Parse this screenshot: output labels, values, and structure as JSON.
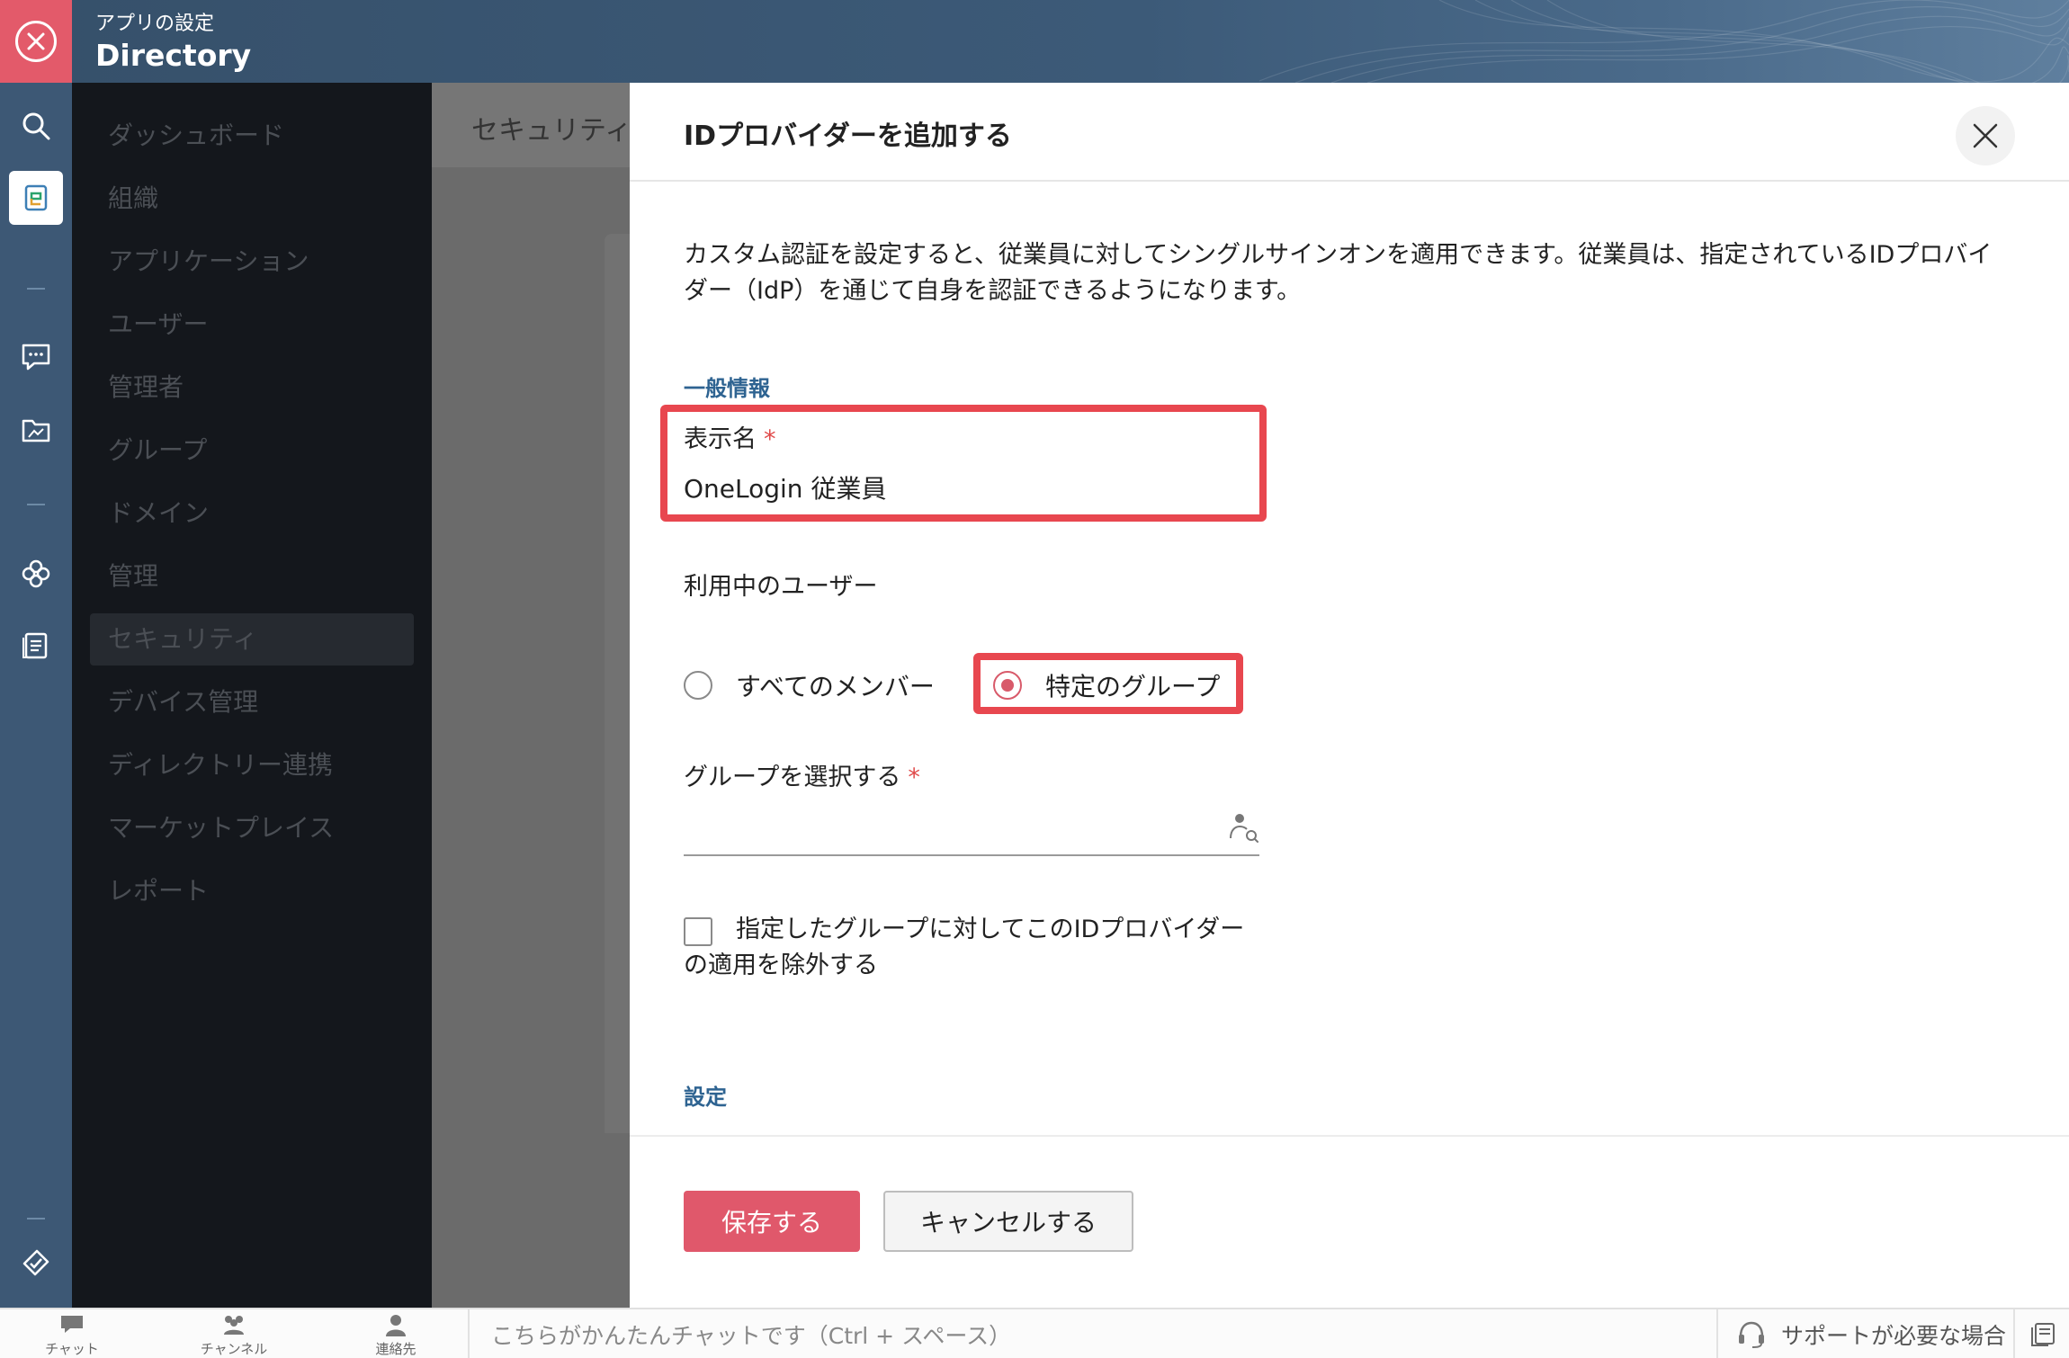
{
  "header": {
    "subtitle": "アプリの設定",
    "title": "Directory"
  },
  "rail": {
    "items": [
      "search-icon",
      "directory-app-icon",
      "chat-icon",
      "folder-icon",
      "clover-icon",
      "notes-icon",
      "tickets-icon"
    ]
  },
  "nav": {
    "items": [
      {
        "label": "ダッシュボード"
      },
      {
        "label": "組織"
      },
      {
        "label": "アプリケーション"
      },
      {
        "label": "ユーザー"
      },
      {
        "label": "管理者"
      },
      {
        "label": "グループ"
      },
      {
        "label": "ドメイン"
      },
      {
        "label": "管理"
      },
      {
        "label": "セキュリティ",
        "active": true
      },
      {
        "label": "デバイス管理"
      },
      {
        "label": "ディレクトリー連携"
      },
      {
        "label": "マーケットプレイス"
      },
      {
        "label": "レポート"
      }
    ]
  },
  "main": {
    "tab_label": "セキュリティ"
  },
  "panel": {
    "title": "IDプロバイダーを追加する",
    "description": "カスタム認証を設定すると、従業員に対してシングルサインオンを適用できます。従業員は、指定されているIDプロバイダー（IdP）を通じて自身を認証できるようになります。",
    "general_section": "一般情報",
    "display_name_label": "表示名",
    "required_mark": "*",
    "display_name_value": "OneLogin 従業員",
    "users_label": "利用中のユーザー",
    "radio_all_label": "すべてのメンバー",
    "radio_group_label": "特定のグループ",
    "selected_radio": "特定のグループ",
    "select_group_label": "グループを選択する",
    "exclude_label": "指定したグループに対してこのIDプロバイダーの適用を除外する",
    "settings_section": "設定",
    "save_label": "保存する",
    "cancel_label": "キャンセルする"
  },
  "bottom_bar": {
    "chat": "チャット",
    "channels": "チャンネル",
    "contacts": "連絡先",
    "chat_placeholder": "こちらがかんたんチャットです（Ctrl + スペース）",
    "support": "サポートが必要な場合"
  },
  "colors": {
    "header_bg": "#3c5a78",
    "accent": "#e0586b",
    "highlight": "#e8474f",
    "section_title": "#2e6391"
  }
}
